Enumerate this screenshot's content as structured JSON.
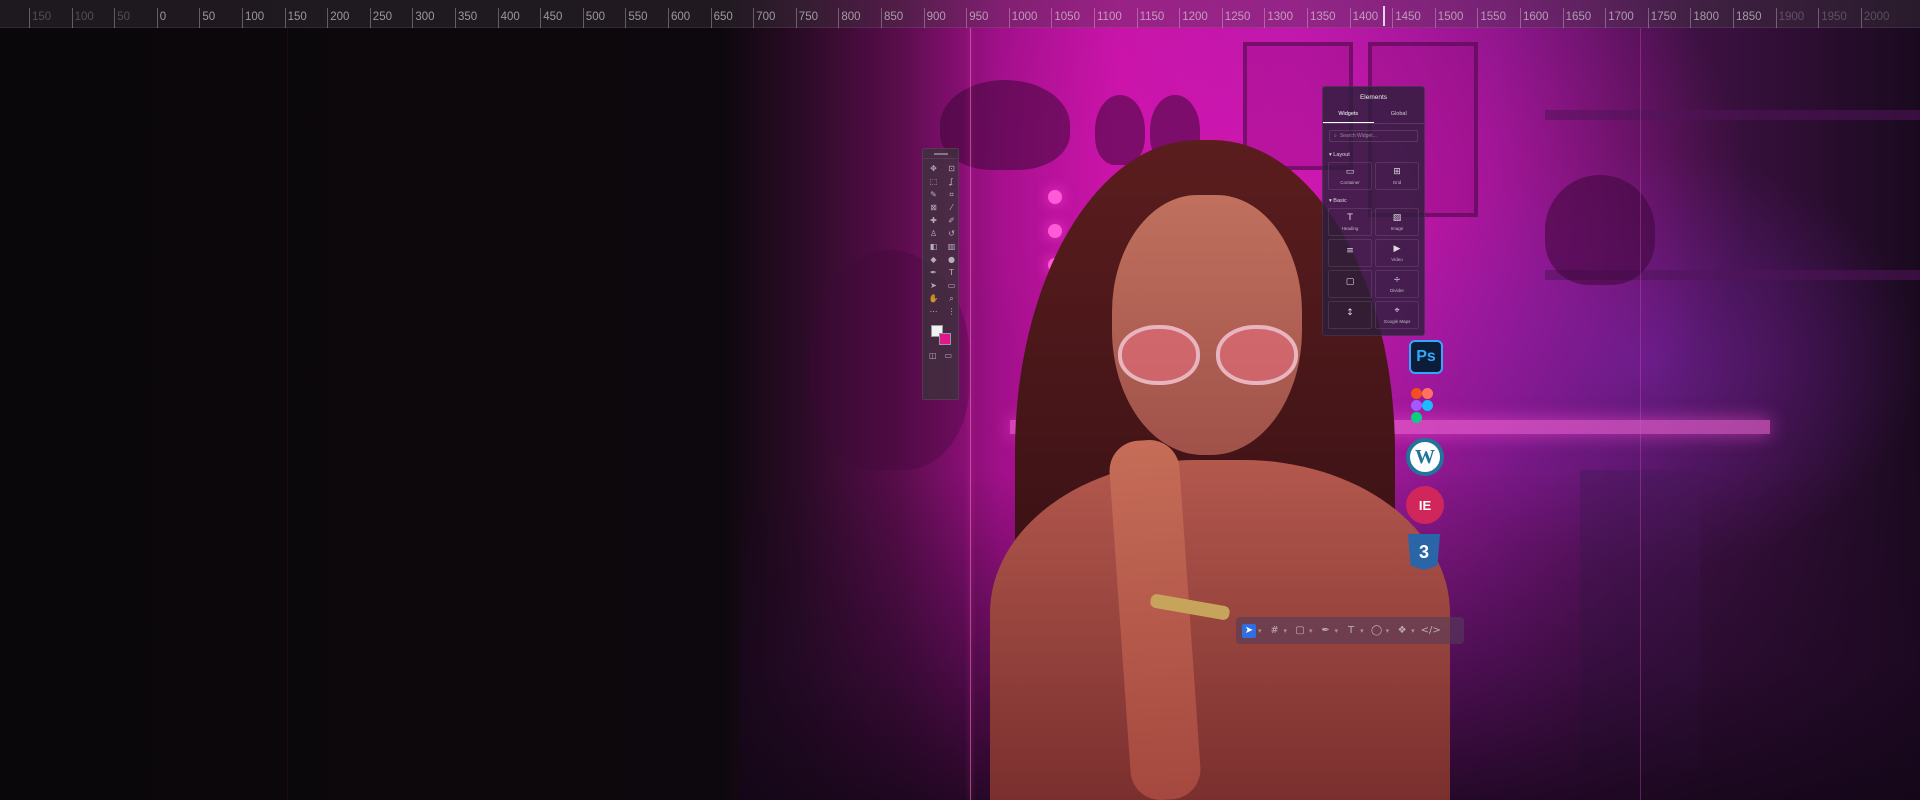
{
  "ruler": {
    "labels": [
      "150",
      "100",
      "50",
      "0",
      "50",
      "100",
      "150",
      "200",
      "250",
      "300",
      "350",
      "400",
      "450",
      "500",
      "550",
      "600",
      "650",
      "700",
      "750",
      "800",
      "850",
      "900",
      "950",
      "1000",
      "1050",
      "1100",
      "1150",
      "1200",
      "1250",
      "1300",
      "1350",
      "1400",
      "1450",
      "1500",
      "1550",
      "1600",
      "1650",
      "1700",
      "1750",
      "1800",
      "1850",
      "1900",
      "1950",
      "2000"
    ]
  },
  "tools_panel": {
    "icons": [
      "move-icon",
      "artboard-icon",
      "marquee-icon",
      "lasso-icon",
      "quick-select-icon",
      "crop-icon",
      "frame-icon",
      "eyedropper-icon",
      "spot-heal-icon",
      "brush-icon",
      "clone-stamp-icon",
      "history-brush-icon",
      "eraser-icon",
      "gradient-icon",
      "blur-icon",
      "dodge-icon",
      "pen-icon",
      "type-icon",
      "path-select-icon",
      "rectangle-icon",
      "hand-icon",
      "zoom-icon",
      "edit-toolbar-icon",
      "more-icon"
    ],
    "foreground_color": "#f2f2f2",
    "background_color": "#e0188e"
  },
  "elementor_panel": {
    "title": "Elements",
    "tabs": [
      {
        "label": "Widgets",
        "active": true
      },
      {
        "label": "Global",
        "active": false
      }
    ],
    "search_placeholder": "Search Widget...",
    "sections": [
      {
        "title": "Layout",
        "widgets": [
          {
            "label": "Container",
            "icon": "container-icon"
          },
          {
            "label": "Grid",
            "icon": "grid-icon"
          }
        ]
      },
      {
        "title": "Basic",
        "widgets": [
          {
            "label": "Heading",
            "icon": "heading-icon"
          },
          {
            "label": "Image",
            "icon": "image-icon"
          },
          {
            "label": "",
            "icon": "text-editor-icon"
          },
          {
            "label": "Video",
            "icon": "video-icon"
          },
          {
            "label": "",
            "icon": "button-icon"
          },
          {
            "label": "Divider",
            "icon": "divider-icon"
          },
          {
            "label": "",
            "icon": "spacer-icon"
          },
          {
            "label": "Google Maps",
            "icon": "google-maps-icon"
          }
        ]
      }
    ]
  },
  "app_icons": {
    "photoshop": "Ps",
    "wordpress": "W",
    "elementor": "IE",
    "css": "3"
  },
  "figma_colors": [
    "#f24e1e",
    "#ff7262",
    "#a259ff",
    "#1abcfe",
    "#0acf83"
  ],
  "float_toolbar": {
    "tools": [
      "select-icon",
      "frame-tool-icon",
      "shape-tool-icon",
      "pen-tool-icon",
      "text-tool-icon",
      "comment-tool-icon",
      "component-icon",
      "dev-mode-icon"
    ],
    "active": "select-icon"
  }
}
